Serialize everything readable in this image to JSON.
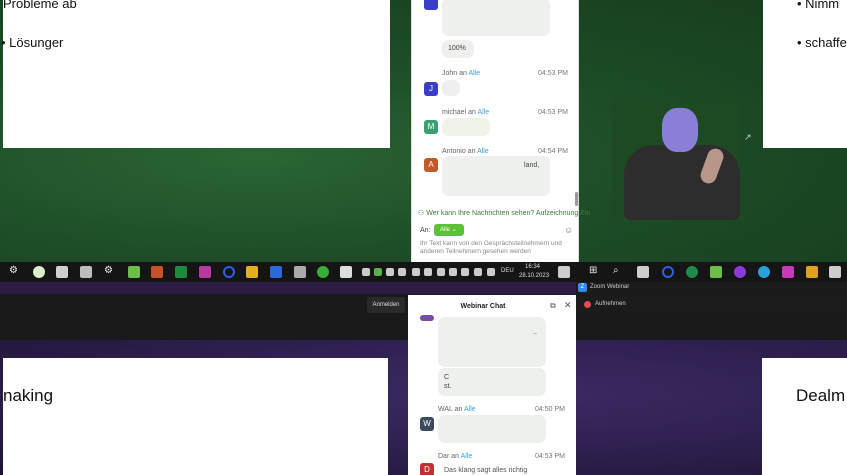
{
  "top_slide_left": {
    "line1": "Probleme ab",
    "line2": "Lösunger"
  },
  "top_slide_right": {
    "line1": "Nimm",
    "line2": "schaffe"
  },
  "chat_top": {
    "progress": "100%",
    "messages": [
      {
        "sender": "John",
        "to": "Alle",
        "time": "04:53 PM",
        "avatar": "J",
        "color": "#3a3fc8"
      },
      {
        "sender": "michael",
        "to": "Alle",
        "time": "04:53 PM",
        "avatar": "M",
        "color": "#3a9e6e"
      },
      {
        "sender": "Antonio",
        "to": "Alle",
        "time": "04:54 PM",
        "avatar": "A",
        "color": "#c05a2a"
      }
    ],
    "msg3_fragment": "land,",
    "who_can_see": "Wer kann Ihre Nachrichten sehen? Aufzeichnung Ein",
    "to_label": "An:",
    "to_value": "Alle",
    "notice": "Ihr Text kann von den Gesprächsteilnehmern und anderen Teilnehmern gesehen werden",
    "an": "an"
  },
  "taskbar": {
    "lang": "DEU",
    "time": "16:34",
    "date": "28.10.2023"
  },
  "bottom_slide_left": {
    "text": "naking"
  },
  "bottom_slide_right": {
    "text": "Dealm"
  },
  "chat_bottom": {
    "title": "Webinar Chat",
    "messages": [
      {
        "sender": "WAL",
        "to": "Alle",
        "time": "04:50 PM",
        "avatar": "W",
        "color": "#3b4a5e"
      },
      {
        "sender": "Dar",
        "to": "Alle",
        "time": "04:53 PM",
        "avatar": "D",
        "color": "#c03030"
      }
    ],
    "frag_dots": "..",
    "frag_c": "C",
    "frag_st": "st.",
    "frag_last": "Das klang sagt alles richtig",
    "an": "an"
  },
  "zoom": {
    "title": "Zoom Webinar",
    "rec": "Aufnehmen",
    "signin": "Anmelden"
  }
}
